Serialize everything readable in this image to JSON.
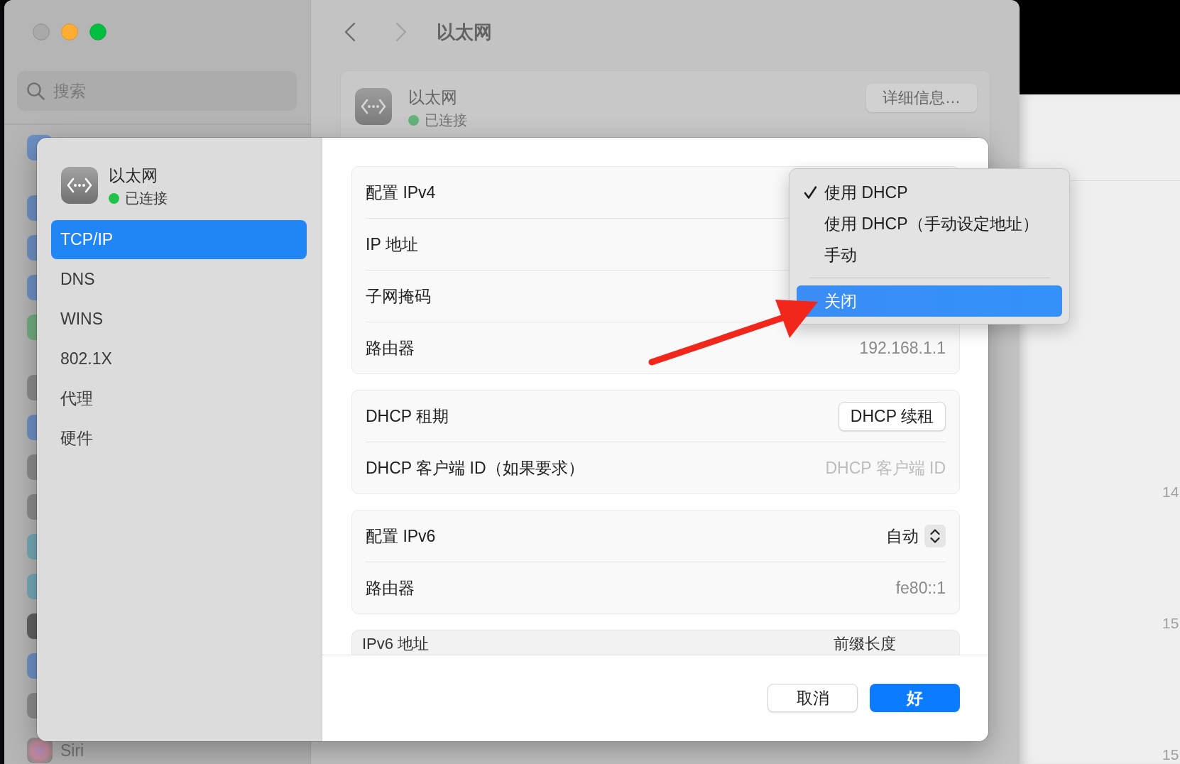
{
  "background_window": {
    "search": {
      "placeholder": "搜索"
    },
    "sidebar_items": [
      {
        "label": "Siri"
      }
    ],
    "navigation": {
      "back_disabled": false,
      "forward_disabled": true
    },
    "title": "以太网",
    "connection": {
      "name": "以太网",
      "status": "已连接",
      "connected": true,
      "button": "详细信息…"
    }
  },
  "dialog": {
    "header": {
      "name": "以太网",
      "status": "已连接",
      "connected": true
    },
    "tabs": [
      {
        "label": "TCP/IP",
        "selected": true
      },
      {
        "label": "DNS",
        "selected": false
      },
      {
        "label": "WINS",
        "selected": false
      },
      {
        "label": "802.1X",
        "selected": false
      },
      {
        "label": "代理",
        "selected": false
      },
      {
        "label": "硬件",
        "selected": false
      }
    ],
    "groups": [
      {
        "rows": [
          {
            "kind": "popup",
            "label": "配置 IPv4"
          },
          {
            "kind": "text",
            "label": "IP 地址"
          },
          {
            "kind": "text",
            "label": "子网掩码"
          },
          {
            "kind": "text",
            "label": "路由器",
            "value": "192.168.1.1"
          }
        ]
      },
      {
        "rows": [
          {
            "kind": "button",
            "label": "DHCP 租期",
            "button": "DHCP 续租"
          },
          {
            "kind": "field",
            "label": "DHCP 客户端 ID（如果要求）",
            "placeholder": "DHCP 客户端 ID"
          }
        ]
      },
      {
        "rows": [
          {
            "kind": "popup",
            "label": "配置 IPv6",
            "value": "自动"
          },
          {
            "kind": "text",
            "label": "路由器",
            "value": "fe80::1"
          }
        ]
      }
    ],
    "address_table": {
      "columns": [
        "IPv6 地址",
        "前缀长度"
      ]
    },
    "buttons": [
      {
        "label": "取消",
        "kind": "secondary"
      },
      {
        "label": "好",
        "kind": "primary"
      }
    ]
  },
  "popup_menu": {
    "items": [
      {
        "kind": "option",
        "label": "使用 DHCP",
        "checked": true,
        "highlighted": false
      },
      {
        "kind": "option",
        "label": "使用 DHCP（手动设定地址）",
        "checked": false,
        "highlighted": false
      },
      {
        "kind": "option",
        "label": "手动",
        "checked": false,
        "highlighted": false
      },
      {
        "kind": "separator"
      },
      {
        "kind": "option",
        "label": "关闭",
        "checked": false,
        "highlighted": true
      }
    ]
  },
  "right_window": {
    "labels": [
      "14",
      "15",
      "15"
    ]
  }
}
